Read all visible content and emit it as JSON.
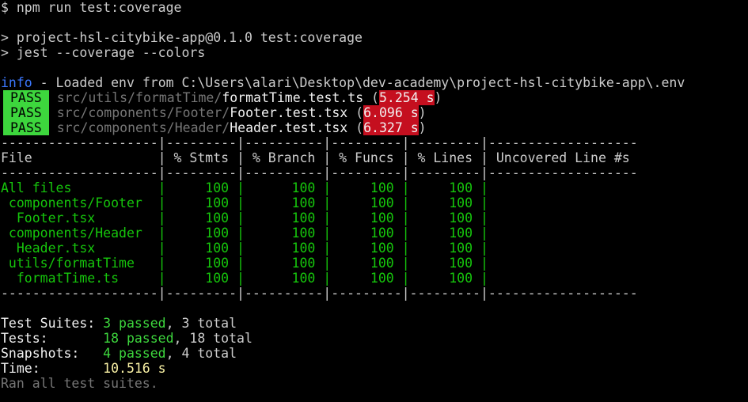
{
  "terminal": {
    "command_line": "$ npm run test:coverage",
    "script_header": "> project-hsl-citybike-app@0.1.0 test:coverage",
    "script_cmd": "> jest --coverage --colors",
    "info": {
      "tag": "info",
      "message": " - Loaded env from C:\\Users\\alari\\Desktop\\dev-academy\\project-hsl-citybike-app\\.env"
    },
    "results": [
      {
        "status": "PASS",
        "dir": "src/utils/formatTime/",
        "file": "formatTime.test.ts",
        "time": "5.254 s"
      },
      {
        "status": "PASS",
        "dir": "src/components/Footer/",
        "file": "Footer.test.tsx",
        "time": "6.096 s"
      },
      {
        "status": "PASS",
        "dir": "src/components/Header/",
        "file": "Header.test.tsx",
        "time": "6.327 s"
      }
    ],
    "coverage_table": {
      "separator": "--------------------|---------|----------|---------|---------|-------------------",
      "header": "File                | % Stmts | % Branch | % Funcs | % Lines | Uncovered Line #s ",
      "rows": [
        "All files           |     100 |      100 |     100 |     100 |                   ",
        " components/Footer  |     100 |      100 |     100 |     100 |                   ",
        "  Footer.tsx        |     100 |      100 |     100 |     100 |                   ",
        " components/Header  |     100 |      100 |     100 |     100 |                   ",
        "  Header.tsx        |     100 |      100 |     100 |     100 |                   ",
        " utils/formatTime   |     100 |      100 |     100 |     100 |                   ",
        "  formatTime.ts     |     100 |      100 |     100 |     100 |                   "
      ]
    },
    "summary": {
      "suites_label": "Test Suites: ",
      "suites_passed": "3 passed",
      "suites_total": ", 3 total",
      "tests_label": "Tests:       ",
      "tests_passed": "18 passed",
      "tests_total": ", 18 total",
      "snapshots_label": "Snapshots:   ",
      "snapshots_passed": "4 passed",
      "snapshots_total": ", 4 total",
      "time_label": "Time:        ",
      "time_value": "10.516 s",
      "ran_all": "Ran all test suites."
    }
  },
  "colors": {
    "background": "#000000",
    "foreground": "#cccccc",
    "pass_badge": "#3dd63d",
    "time_badge": "#c50f1f",
    "info": "#3b78ff",
    "path_gray": "#767676",
    "green_text": "#16c60c",
    "yellow_text": "#f9f1a5"
  }
}
